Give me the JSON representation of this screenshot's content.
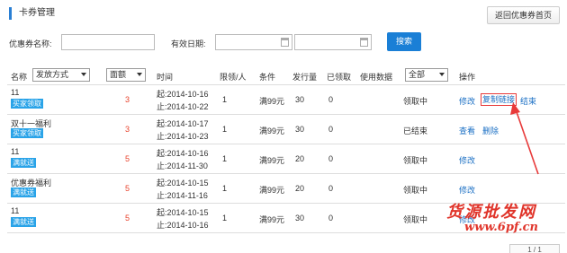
{
  "header": {
    "title": "卡券管理",
    "back_label": "返回优惠券首页"
  },
  "filter": {
    "name_label": "优惠券名称:",
    "name_value": "",
    "date_label": "有效日期:",
    "date_sep": "-",
    "search_label": "搜索"
  },
  "table": {
    "headers": {
      "name": "名称",
      "issue_type": "发放方式",
      "face_value": "面额",
      "time": "时间",
      "limit": "限领/人",
      "condition": "条件",
      "issued": "发行量",
      "received": "已领取",
      "used": "使用数据",
      "status": "全部",
      "action": "操作"
    },
    "rows": [
      {
        "name": "11",
        "tag": "买家领取",
        "value": "3",
        "start": "起:2014-10-16",
        "end": "止:2014-10-22",
        "limit": "1",
        "cond": "满99元",
        "issued": "30",
        "received": "0",
        "status": "领取中",
        "actions": [
          "修改",
          "复制链接",
          "结束"
        ]
      },
      {
        "name": "双十一福利",
        "tag": "买家领取",
        "value": "3",
        "start": "起:2014-10-17",
        "end": "止:2014-10-23",
        "limit": "1",
        "cond": "满99元",
        "issued": "30",
        "received": "0",
        "status": "已结束",
        "actions": [
          "查看",
          "删除"
        ]
      },
      {
        "name": "11",
        "tag": "满就送",
        "value": "5",
        "start": "起:2014-10-16",
        "end": "止:2014-11-30",
        "limit": "1",
        "cond": "满99元",
        "issued": "20",
        "received": "0",
        "status": "领取中",
        "actions": [
          "修改"
        ]
      },
      {
        "name": "优惠券福利",
        "tag": "满就送",
        "value": "5",
        "start": "起:2014-10-15",
        "end": "止:2014-11-16",
        "limit": "1",
        "cond": "满99元",
        "issued": "20",
        "received": "0",
        "status": "领取中",
        "actions": [
          "修改"
        ]
      },
      {
        "name": "11",
        "tag": "满就送",
        "value": "5",
        "start": "起:2014-10-15",
        "end": "止:2014-10-16",
        "limit": "1",
        "cond": "满99元",
        "issued": "30",
        "received": "0",
        "status": "领取中",
        "actions": [
          "修改"
        ]
      }
    ]
  },
  "watermark": {
    "line1": "货源批发网",
    "line2": "www.6pf.cn"
  },
  "pager": {
    "text": "1 / 1"
  },
  "colors": {
    "accent": "#1a7fd6",
    "tag": "#29a3e8",
    "qty": "#e8432d",
    "highlight": "#e83a3a"
  }
}
